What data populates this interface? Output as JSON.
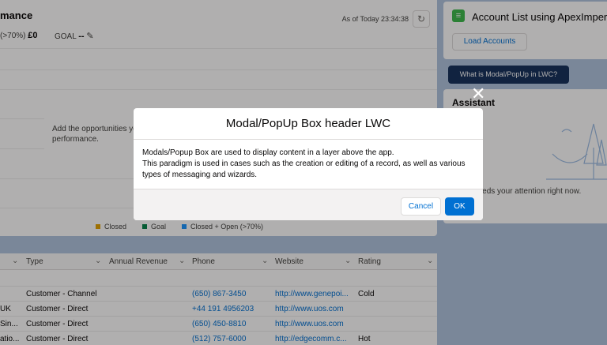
{
  "performance": {
    "title": "mance",
    "as_of": "As of Today 23:34:38",
    "closed_open_label": "(>70%)",
    "closed_open_value": "£0",
    "goal_label": "GOAL",
    "goal_value": "--",
    "note": "Add the opportunities yo performance.",
    "legend": [
      {
        "label": "Closed",
        "color": "#e4a201"
      },
      {
        "label": "Goal",
        "color": "#04844b"
      },
      {
        "label": "Closed + Open (>70%)",
        "color": "#1b96ff"
      }
    ]
  },
  "account_list": {
    "title": "Account List using ApexImperativ",
    "load_button": "Load Accounts"
  },
  "what_button": "What is Modal/PopUp in LWC?",
  "assistant": {
    "title": "Assistant",
    "message": "othing needs your attention right now."
  },
  "table": {
    "headers": [
      "Type",
      "Annual Revenue",
      "Phone",
      "Website",
      "Rating"
    ],
    "rows": [
      {
        "name": "",
        "type": "Customer - Channel",
        "revenue": "",
        "phone": "(650) 867-3450",
        "website": "http://www.genepoi...",
        "rating": "Cold"
      },
      {
        "name": "UK",
        "type": "Customer - Direct",
        "revenue": "",
        "phone": "+44 191 4956203",
        "website": "http://www.uos.com",
        "rating": ""
      },
      {
        "name": "Sin...",
        "type": "Customer - Direct",
        "revenue": "",
        "phone": "(650) 450-8810",
        "website": "http://www.uos.com",
        "rating": ""
      },
      {
        "name": "atio...",
        "type": "Customer - Direct",
        "revenue": "",
        "phone": "(512) 757-6000",
        "website": "http://edgecomm.c...",
        "rating": "Hot"
      }
    ]
  },
  "modal": {
    "title": "Modal/PopUp Box header LWC",
    "body_line1": "Modals/Popup Box are used to display content in a layer above the app.",
    "body_line2": "This paradigm is used in cases such as the creation or editing of a record, as well as various types of messaging and wizards.",
    "cancel": "Cancel",
    "ok": "OK",
    "close_icon": "close-icon"
  },
  "colors": {
    "brand": "#0070d2",
    "dark_button": "#16325c",
    "backdrop": "rgba(8,7,7,0.32)"
  }
}
